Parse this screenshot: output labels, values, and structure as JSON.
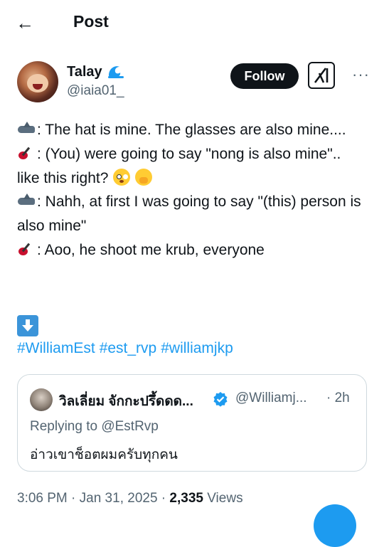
{
  "header": {
    "back_icon": "arrow-left-icon",
    "title": "Post"
  },
  "author": {
    "name": "Talay",
    "name_emoji": "water-wave-icon",
    "handle": "@iaia01_",
    "follow_label": "Follow",
    "grok_icon": "grok-icon",
    "more_icon": "more-icon"
  },
  "post": {
    "lines": [
      {
        "emoji": "shark-icon",
        "text": ": The hat is mine. The glasses are also mine...."
      },
      {
        "emoji": "guitar-icon",
        "text": ": (You) were going to say \"nong is also mine\".. like this right?"
      },
      {
        "emoji": "shark-icon",
        "text": ": Nahh, at first I was going to say \"(this) person is also mine\""
      },
      {
        "emoji": "guitar-icon",
        "text": ": Aoo, he shoot me krub, everyone"
      }
    ],
    "hashtags": [
      "#WilliamEst",
      "#est_rvp",
      "#williamjkp"
    ]
  },
  "quote": {
    "name": "วิลเลี่ยม จักกะปรึ้ดดด...",
    "handle": "@Williamj...",
    "time": "· 2h",
    "replying": "Replying to @EstRvp",
    "text": "อ่าวเขาช็อตผมครับทุกคน"
  },
  "meta": {
    "time": "3:06 PM · Jan 31, 2025 · ",
    "views_count": "2,335",
    "views_label": " Views"
  },
  "colors": {
    "accent": "#1d9bf0",
    "text": "#0f1419",
    "secondary": "#536471",
    "border": "#cfd9de"
  }
}
